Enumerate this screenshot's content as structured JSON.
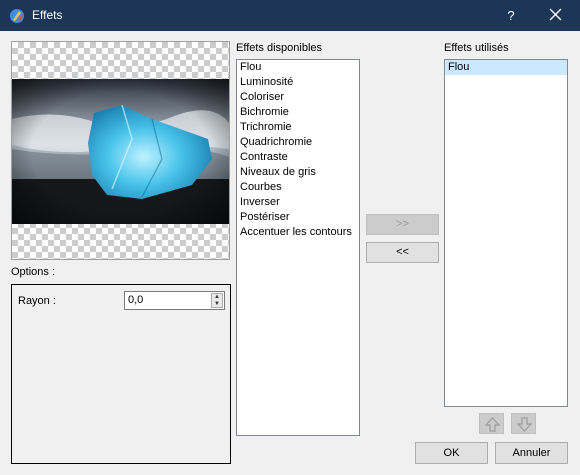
{
  "window": {
    "title": "Effets",
    "help_label": "?",
    "icon": "app-logo-icon",
    "close_icon": "close-icon"
  },
  "left": {
    "options_label": "Options :",
    "rayon_label": "Rayon :",
    "rayon_value": "0,0"
  },
  "available": {
    "label": "Effets disponibles",
    "items": [
      "Flou",
      "Luminosité",
      "Coloriser",
      "Bichromie",
      "Trichromie",
      "Quadrichromie",
      "Contraste",
      "Niveaux de gris",
      "Courbes",
      "Inverser",
      "Postériser",
      "Accentuer les contours"
    ]
  },
  "transfer": {
    "add_label": ">>",
    "remove_label": "<<"
  },
  "used": {
    "label": "Effets utilisés",
    "items": [
      "Flou"
    ],
    "selected": "Flou"
  },
  "order": {
    "up_icon": "arrow-up-icon",
    "down_icon": "arrow-down-icon"
  },
  "footer": {
    "ok_label": "OK",
    "cancel_label": "Annuler"
  }
}
